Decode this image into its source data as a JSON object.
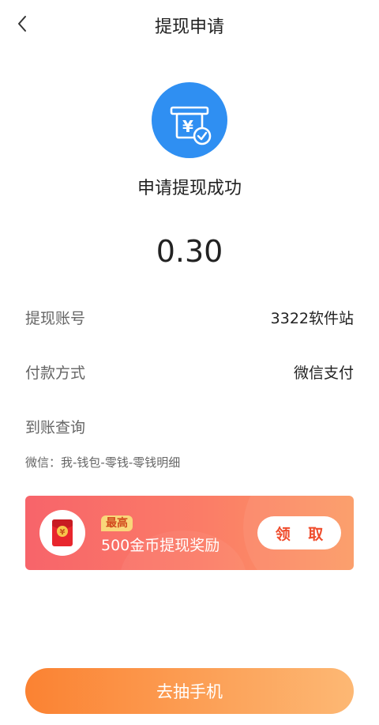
{
  "header": {
    "title": "提现申请",
    "back_icon": "chevron-left-icon"
  },
  "result": {
    "icon": "atm-yuan-check-icon",
    "message": "申请提现成功",
    "amount": "0.30"
  },
  "details": {
    "account_label": "提现账号",
    "account_value": "3322软件站",
    "payment_label": "付款方式",
    "payment_value": "微信支付",
    "query_label": "到账查询",
    "query_detail": "微信：我-钱包-零钱-零钱明细"
  },
  "banner": {
    "icon": "red-envelope-yuan-icon",
    "badge": "最高",
    "text": "500金币提现奖励",
    "button": "领 取"
  },
  "action": {
    "button": "去抽手机"
  },
  "colors": {
    "primary_blue": "#2f8ff2",
    "banner_red": "#f7646a",
    "banner_orange": "#fb9a64",
    "button_orange_start": "#fb8232",
    "button_orange_end": "#fdb874"
  }
}
